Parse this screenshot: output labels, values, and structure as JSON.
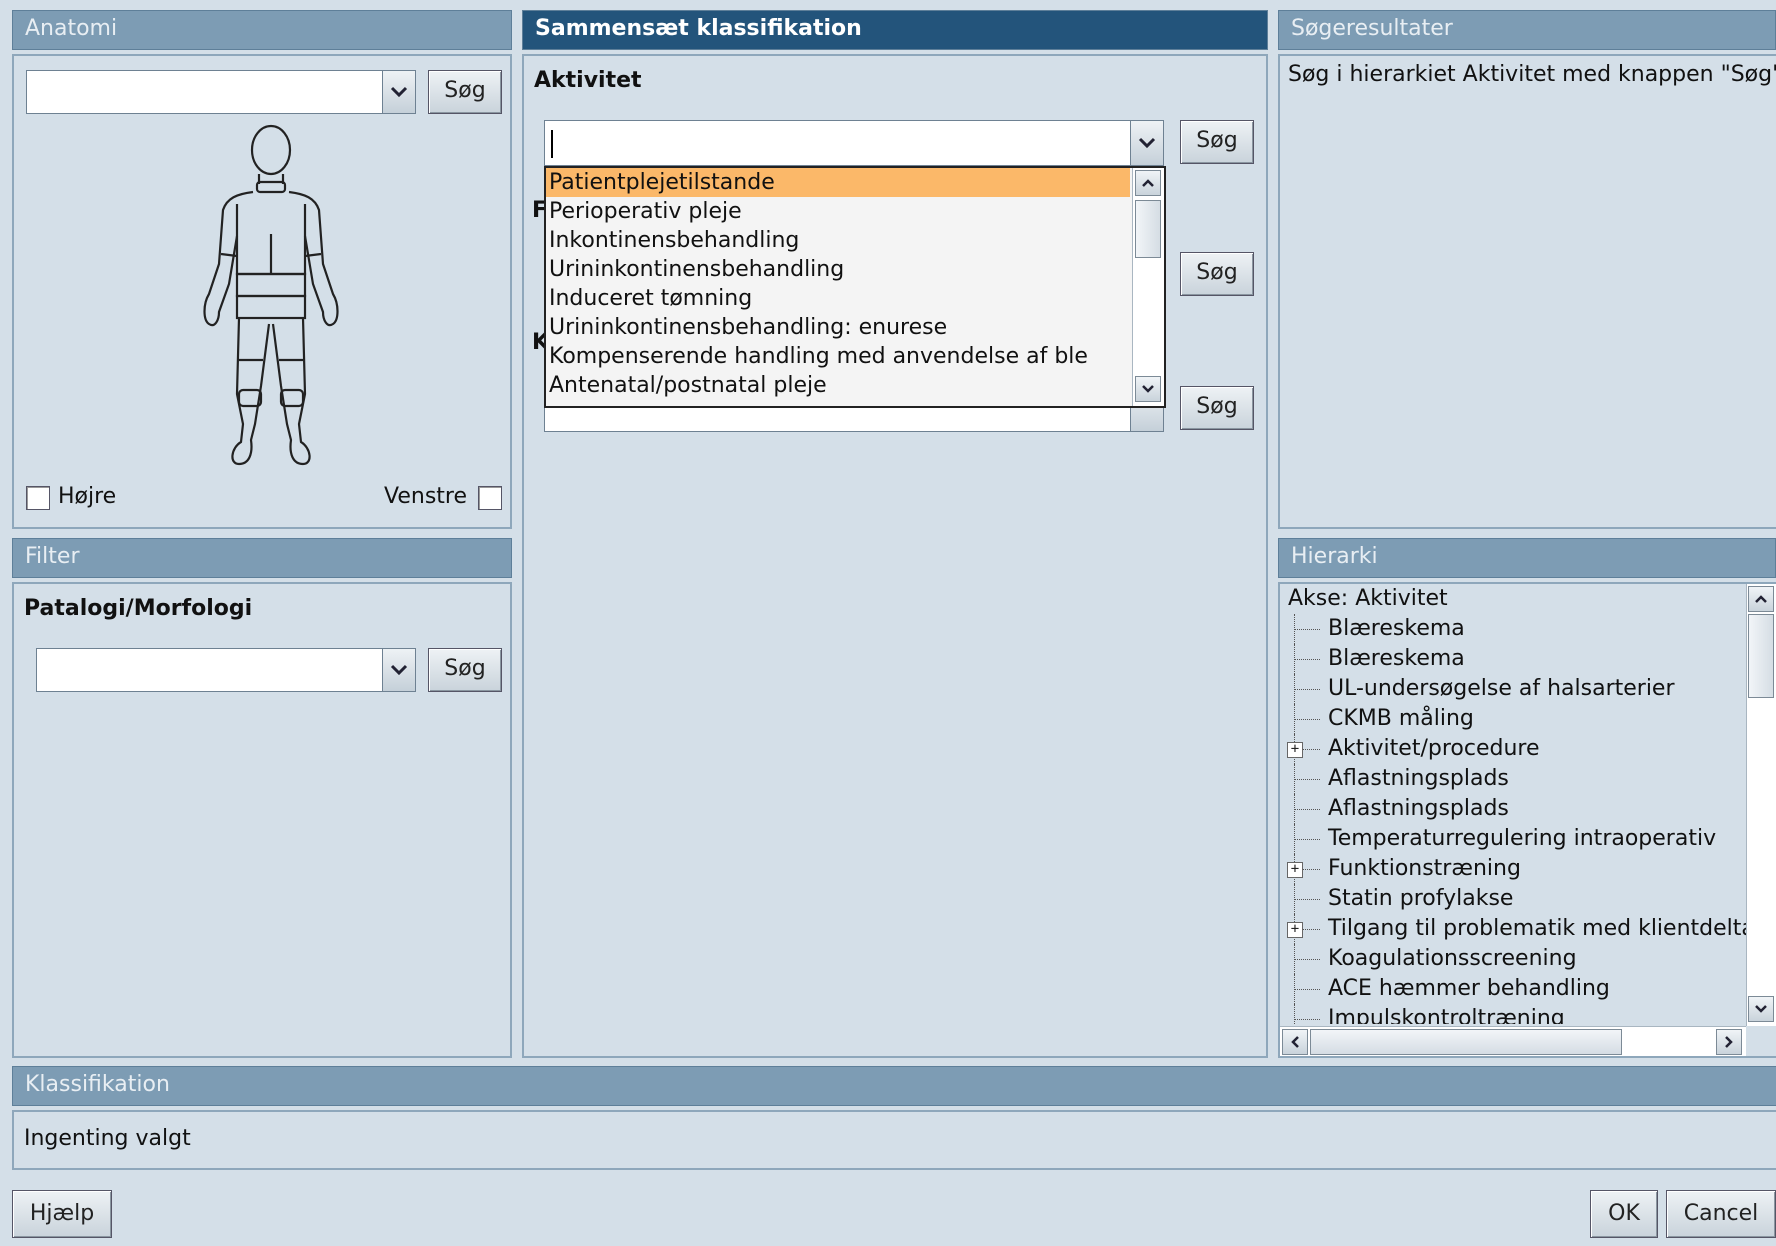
{
  "anatomi": {
    "header": "Anatomi",
    "search_label": "Søg",
    "right_label": "Højre",
    "left_label": "Venstre"
  },
  "filter": {
    "header": "Filter",
    "subtitle": "Patalogi/Morfologi",
    "search_label": "Søg"
  },
  "compose": {
    "header": "Sammensæt klassifikation",
    "section_label": "Aktivitet",
    "search_label": "Søg",
    "hidden_label_1": "F",
    "hidden_label_2": "K",
    "dropdown_items": [
      "Patientplejetilstande",
      "Perioperativ pleje",
      "Inkontinensbehandling",
      "Urininkontinensbehandling",
      "Induceret tømning",
      "Urininkontinensbehandling: enurese",
      "Kompenserende handling med anvendelse af ble",
      "Antenatal/postnatal pleje"
    ]
  },
  "results": {
    "header": "Søgeresultater",
    "message": "Søg i hierarkiet Aktivitet med knappen \"Søg\""
  },
  "hierarchy": {
    "header": "Hierarki",
    "root": "Akse: Aktivitet",
    "items": [
      {
        "label": "Blæreskema",
        "expandable": false
      },
      {
        "label": "Blæreskema",
        "expandable": false
      },
      {
        "label": "UL-undersøgelse af halsarterier",
        "expandable": false
      },
      {
        "label": "CKMB måling",
        "expandable": false
      },
      {
        "label": "Aktivitet/procedure",
        "expandable": true
      },
      {
        "label": "Aflastningsplads",
        "expandable": false
      },
      {
        "label": "Aflastningsplads",
        "expandable": false
      },
      {
        "label": "Temperaturregulering intraoperativ",
        "expandable": false
      },
      {
        "label": "Funktionstræning",
        "expandable": true
      },
      {
        "label": "Statin profylakse",
        "expandable": false
      },
      {
        "label": "Tilgang til problematik med klientdelta",
        "expandable": true
      },
      {
        "label": "Koagulationsscreening",
        "expandable": false
      },
      {
        "label": "ACE hæmmer behandling",
        "expandable": false
      },
      {
        "label": "Impulskontroltræning",
        "expandable": false
      }
    ]
  },
  "classification": {
    "header": "Klassifikation",
    "value": "Ingenting valgt"
  },
  "footer": {
    "help_label": "Hjælp",
    "ok_label": "OK",
    "cancel_label": "Cancel"
  },
  "colors": {
    "selection": "#fbb869",
    "active_header": "#23547b",
    "header": "#7d9cb4",
    "background": "#d4dfe8"
  }
}
